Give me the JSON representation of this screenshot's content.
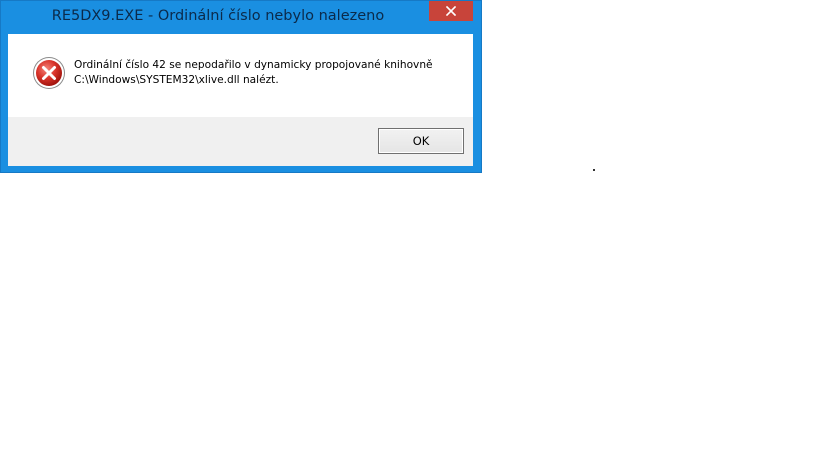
{
  "window": {
    "title": "RE5DX9.EXE - Ordinální číslo nebylo nalezeno",
    "close_icon": "close-icon",
    "frame_color": "#1a8fe1",
    "close_color": "#c8443a"
  },
  "message": {
    "icon": "error-icon",
    "line1": "Ordinální číslo 42 se nepodařilo v dynamicky propojované knihovně",
    "line2": "C:\\Windows\\SYSTEM32\\xlive.dll nalézt."
  },
  "buttons": {
    "ok_label": "OK"
  }
}
